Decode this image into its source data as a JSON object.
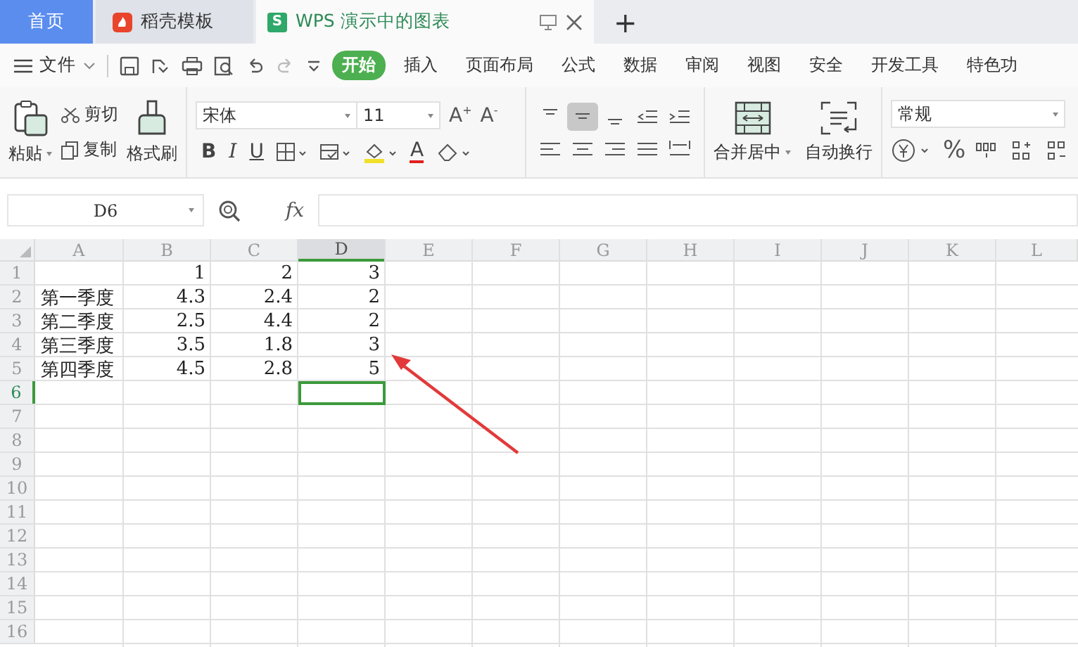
{
  "tabs": [
    {
      "kind": "home",
      "label": "首页",
      "selected": false
    },
    {
      "kind": "docer",
      "label": "稻壳模板",
      "selected": false
    },
    {
      "kind": "sheet",
      "icon_letter": "S",
      "label": "WPS 演示中的图表",
      "selected": true
    }
  ],
  "new_tab": "+",
  "menu": {
    "file": "文件",
    "items": [
      {
        "label": "开始",
        "selected": true
      },
      {
        "label": "插入",
        "selected": false
      },
      {
        "label": "页面布局",
        "selected": false
      },
      {
        "label": "公式",
        "selected": false
      },
      {
        "label": "数据",
        "selected": false
      },
      {
        "label": "审阅",
        "selected": false
      },
      {
        "label": "视图",
        "selected": false
      },
      {
        "label": "安全",
        "selected": false
      },
      {
        "label": "开发工具",
        "selected": false
      },
      {
        "label": "特色功",
        "selected": false
      }
    ]
  },
  "ribbon": {
    "paste": "粘贴",
    "cut": "剪切",
    "copy": "复制",
    "format_painter": "格式刷",
    "font": "宋体",
    "font_size": "11",
    "grow": "A",
    "grow_sign": "+",
    "shrink": "A",
    "shrink_sign": "-",
    "bold": "B",
    "italic": "I",
    "underline": "U",
    "font_color": "A",
    "valign": [
      {
        "selected": false
      },
      {
        "selected": true
      },
      {
        "selected": false
      }
    ],
    "merge": "合并居中",
    "wrap": "自动换行",
    "number_format": "常规",
    "percent": "%"
  },
  "formula_bar": {
    "name_box": "D6",
    "fx": "fx"
  },
  "sheet": {
    "columns": [
      {
        "label": "A",
        "selected": false
      },
      {
        "label": "B",
        "selected": false
      },
      {
        "label": "C",
        "selected": false
      },
      {
        "label": "D",
        "selected": true
      },
      {
        "label": "E",
        "selected": false
      },
      {
        "label": "F",
        "selected": false
      },
      {
        "label": "G",
        "selected": false
      },
      {
        "label": "H",
        "selected": false
      },
      {
        "label": "I",
        "selected": false
      },
      {
        "label": "J",
        "selected": false
      },
      {
        "label": "K",
        "selected": false
      },
      {
        "label": "L",
        "selected": false
      }
    ],
    "rows": [
      {
        "label": "1",
        "selected": false,
        "cells": [
          null,
          "1",
          "2",
          "3"
        ]
      },
      {
        "label": "2",
        "selected": false,
        "cells": [
          "第一季度",
          "4.3",
          "2.4",
          "2"
        ]
      },
      {
        "label": "3",
        "selected": false,
        "cells": [
          "第二季度",
          "2.5",
          "4.4",
          "2"
        ]
      },
      {
        "label": "4",
        "selected": false,
        "cells": [
          "第三季度",
          "3.5",
          "1.8",
          "3"
        ]
      },
      {
        "label": "5",
        "selected": false,
        "cells": [
          "第四季度",
          "4.5",
          "2.8",
          "5"
        ]
      },
      {
        "label": "6",
        "selected": true,
        "cells": []
      },
      {
        "label": "7",
        "selected": false,
        "cells": []
      },
      {
        "label": "8",
        "selected": false,
        "cells": []
      },
      {
        "label": "9",
        "selected": false,
        "cells": []
      },
      {
        "label": "10",
        "selected": false,
        "cells": []
      },
      {
        "label": "11",
        "selected": false,
        "cells": []
      },
      {
        "label": "12",
        "selected": false,
        "cells": []
      },
      {
        "label": "13",
        "selected": false,
        "cells": []
      },
      {
        "label": "14",
        "selected": false,
        "cells": []
      },
      {
        "label": "15",
        "selected": false,
        "cells": []
      },
      {
        "label": "16",
        "selected": false,
        "cells": []
      }
    ]
  }
}
